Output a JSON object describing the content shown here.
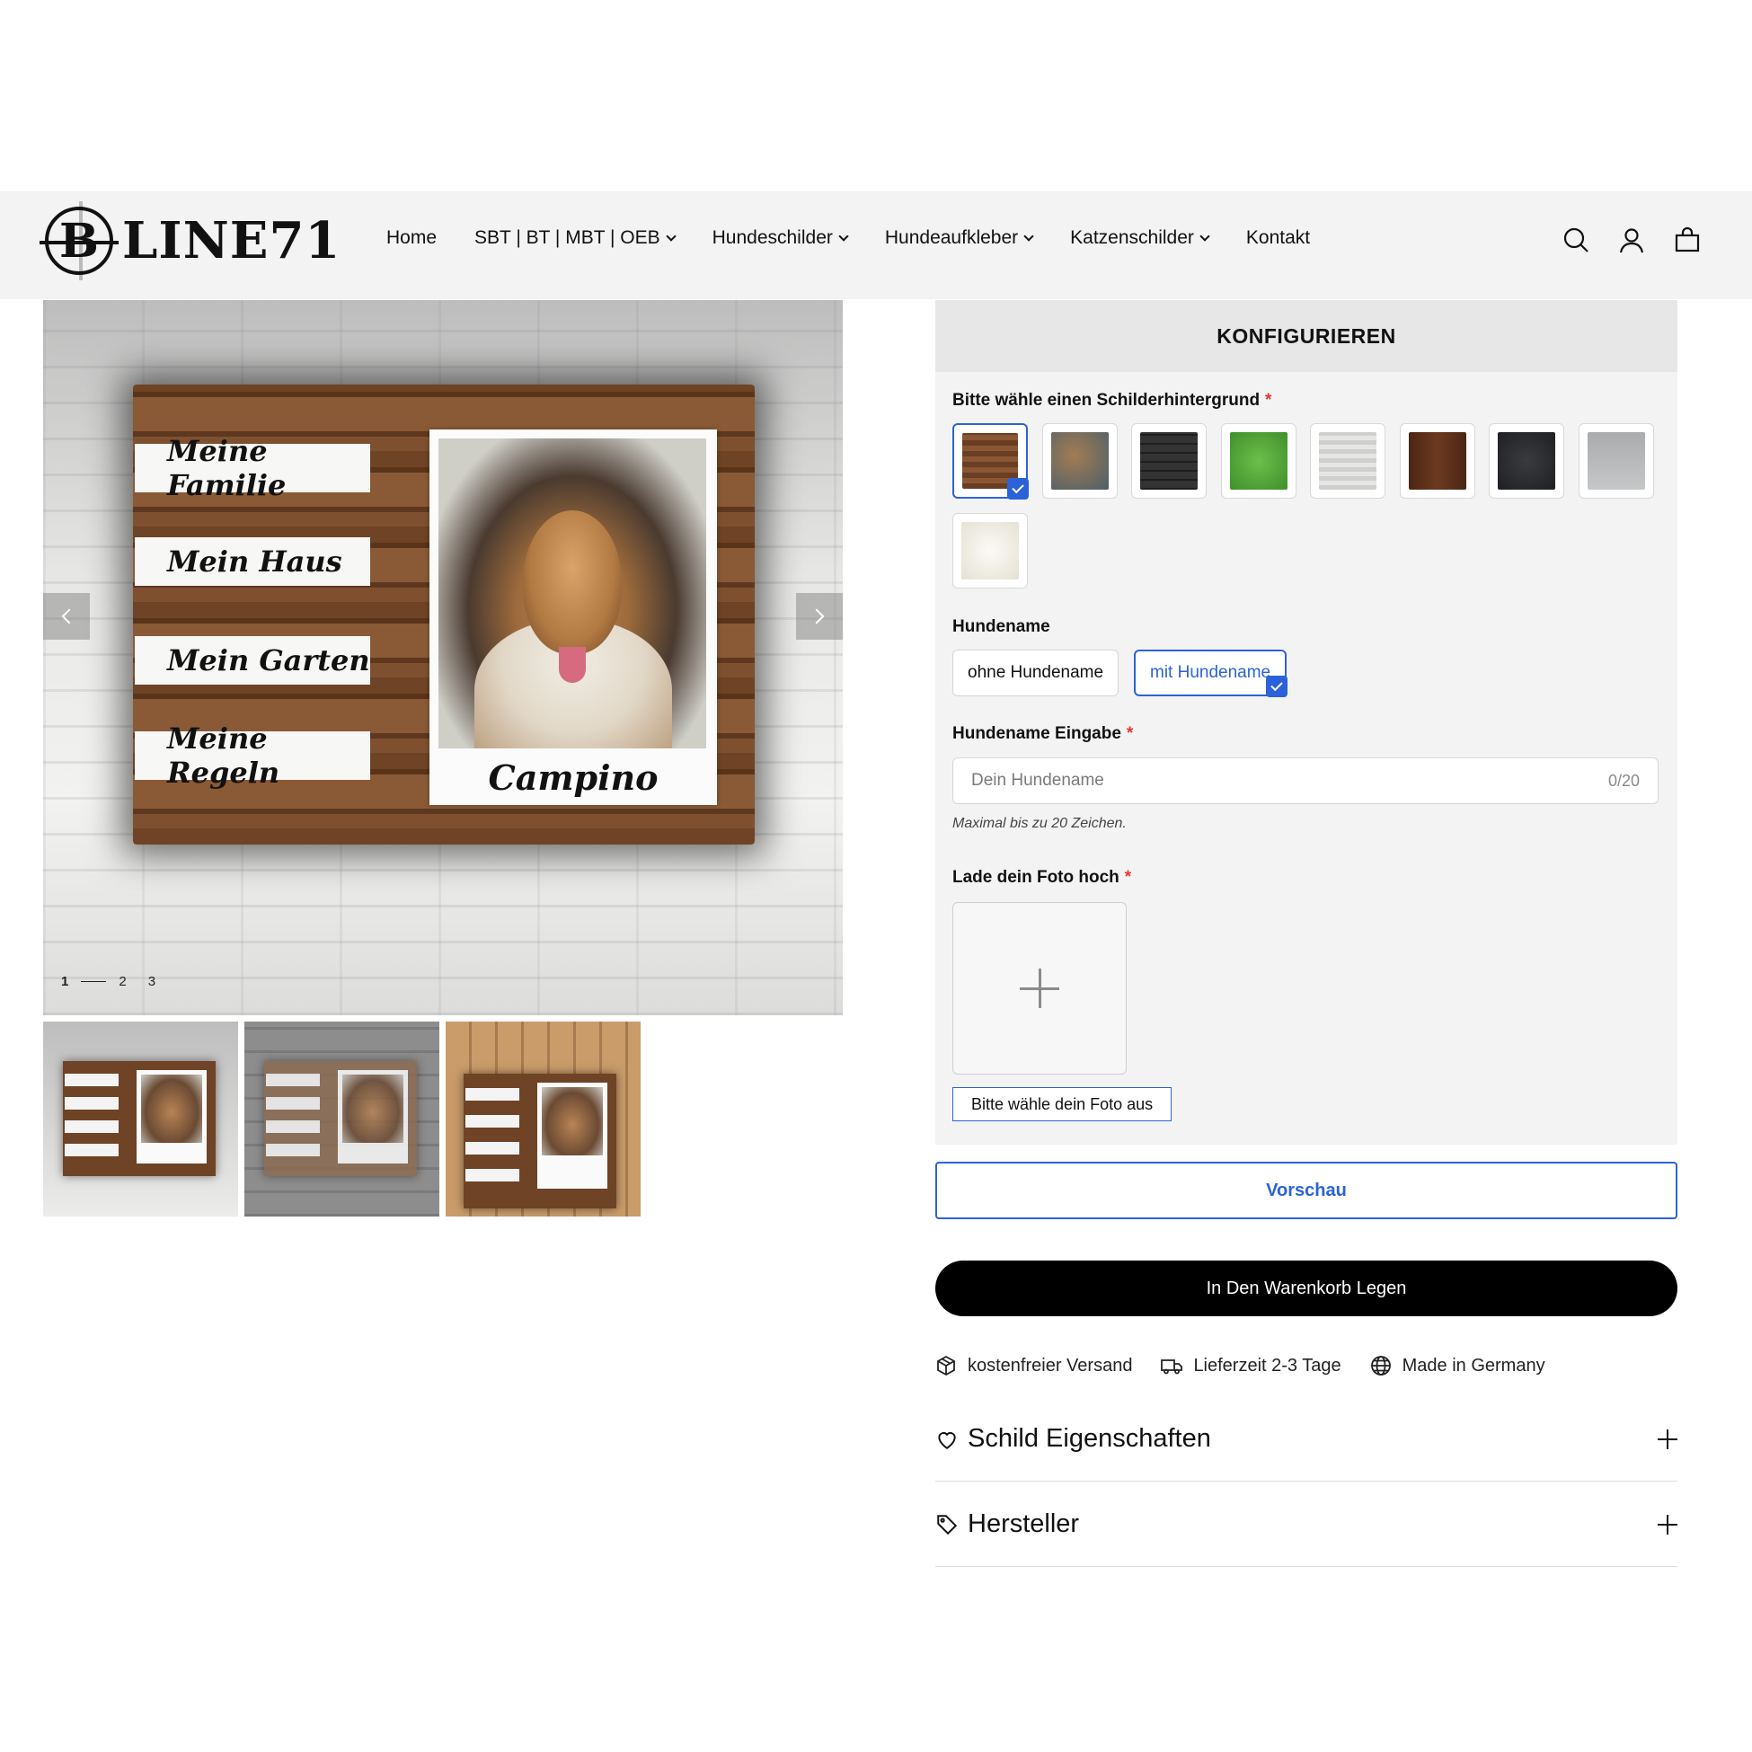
{
  "brand": {
    "logo_letter": "B",
    "logo_text": "LINE71"
  },
  "nav": {
    "items": [
      {
        "label": "Home",
        "dropdown": false
      },
      {
        "label": "SBT | BT | MBT | OEB",
        "dropdown": true
      },
      {
        "label": "Hundeschilder",
        "dropdown": true
      },
      {
        "label": "Hundeaufkleber",
        "dropdown": true
      },
      {
        "label": "Katzenschilder",
        "dropdown": true
      },
      {
        "label": "Kontakt",
        "dropdown": false
      }
    ],
    "icons": [
      "search-icon",
      "account-icon",
      "cart-icon"
    ]
  },
  "gallery": {
    "sign_labels": [
      "Meine Familie",
      "Mein Haus",
      "Mein Garten",
      "Meine Regeln"
    ],
    "photo_caption": "Campino",
    "pager": {
      "pages": [
        "1",
        "2",
        "3"
      ],
      "current": 1
    },
    "thumbnails": 3
  },
  "config": {
    "header": "KONFIGURIEREN",
    "background": {
      "label": "Bitte wähle einen Schilderhintergrund",
      "required_mark": "*",
      "swatches": [
        {
          "name": "wood-brown",
          "color": "#7a4a2b",
          "selected": true
        },
        {
          "name": "rust-blue",
          "color": "#6d6a5c",
          "selected": false
        },
        {
          "name": "black-brick",
          "color": "#2b2b2b",
          "selected": false
        },
        {
          "name": "grass",
          "color": "#5aa03c",
          "selected": false
        },
        {
          "name": "light-wood",
          "color": "#d4d4d2",
          "selected": false
        },
        {
          "name": "dark-wood",
          "color": "#5a301c",
          "selected": false
        },
        {
          "name": "dark-slate",
          "color": "#2c2d30",
          "selected": false
        },
        {
          "name": "silver",
          "color": "#b4b6b7",
          "selected": false
        },
        {
          "name": "cream",
          "color": "#f1efe8",
          "selected": false
        }
      ]
    },
    "dogname": {
      "label": "Hundename",
      "options": [
        {
          "label": "ohne Hundename",
          "selected": false
        },
        {
          "label": "mit Hundename",
          "selected": true
        }
      ]
    },
    "dogname_input": {
      "label": "Hundename Eingabe",
      "required_mark": "*",
      "placeholder": "Dein Hundename",
      "value": "",
      "counter": "0/20",
      "hint": "Maximal bis zu 20 Zeichen."
    },
    "upload": {
      "label": "Lade dein Foto hoch",
      "required_mark": "*",
      "button": "Bitte wähle dein Foto aus"
    }
  },
  "actions": {
    "preview": "Vorschau",
    "add_to_cart": "In Den Warenkorb Legen"
  },
  "features": [
    {
      "icon": "package-icon",
      "label": "kostenfreier Versand"
    },
    {
      "icon": "truck-icon",
      "label": "Lieferzeit 2-3 Tage"
    },
    {
      "icon": "globe-icon",
      "label": "Made in Germany"
    }
  ],
  "accordions": [
    {
      "icon": "heart-icon",
      "title": "Schild Eigenschaften"
    },
    {
      "icon": "tag-icon",
      "title": "Hersteller"
    }
  ],
  "colors": {
    "accent": "#2b62d9",
    "required": "#e23636",
    "header_bg": "#f3f3f3"
  }
}
